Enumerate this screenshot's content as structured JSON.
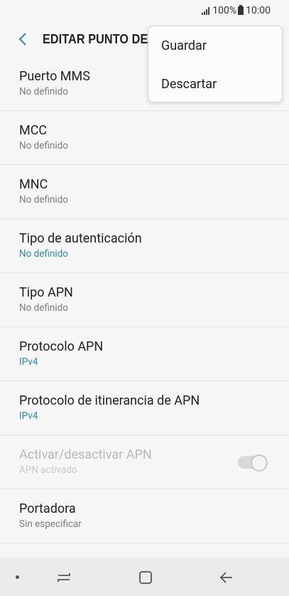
{
  "status_bar": {
    "battery": "100%",
    "time": "10:00"
  },
  "header": {
    "title": "EDITAR PUNTO DE"
  },
  "menu": {
    "items": [
      "Guardar",
      "Descartar"
    ]
  },
  "settings": [
    {
      "title": "Puerto MMS",
      "value": "No definido",
      "accent": false
    },
    {
      "title": "MCC",
      "value": "No definido",
      "accent": false
    },
    {
      "title": "MNC",
      "value": "No definido",
      "accent": false
    },
    {
      "title": "Tipo de autenticación",
      "value": "No definido",
      "accent": true
    },
    {
      "title": "Tipo APN",
      "value": "No definido",
      "accent": false
    },
    {
      "title": "Protocolo APN",
      "value": "IPv4",
      "accent": true
    },
    {
      "title": "Protocolo de itinerancia de APN",
      "value": "IPv4",
      "accent": true
    },
    {
      "title": "Activar/desactivar APN",
      "value": "APN activado",
      "accent": false,
      "disabled": true,
      "toggle": true
    },
    {
      "title": "Portadora",
      "value": "Sin especificar",
      "accent": false
    }
  ],
  "colors": {
    "accent": "#2f8aa6",
    "background": "#f6f6f6"
  }
}
